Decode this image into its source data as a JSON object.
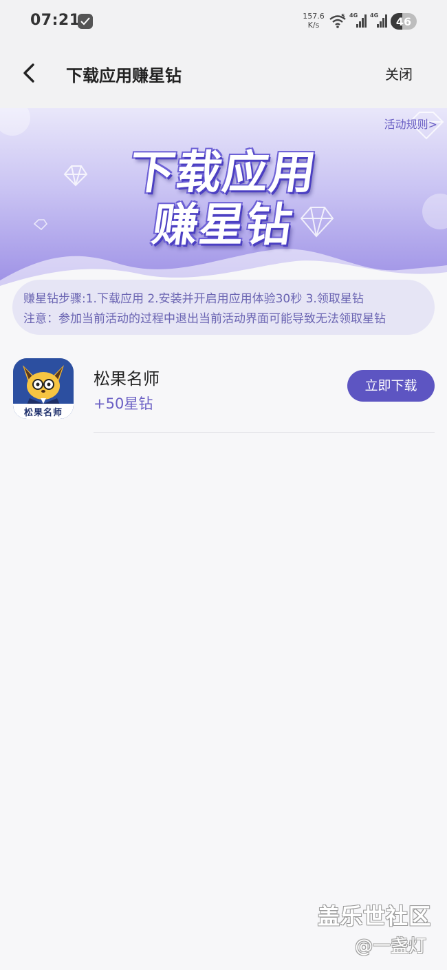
{
  "status_bar": {
    "time": "07:21",
    "net_speed_value": "157.6",
    "net_speed_unit": "K/s",
    "wifi_badge": "5",
    "signal_1_label": "4G",
    "signal_2_label": "4G",
    "battery_level": "46",
    "battery_fraction": 0.46
  },
  "nav": {
    "back_icon": "chevron-left-icon",
    "title": "下载应用赚星钻",
    "close_label": "关闭"
  },
  "banner": {
    "rules_link": "活动规则>",
    "headline_line1": "下载应用",
    "headline_line2": "赚星钻",
    "colors": {
      "top": "#e9e7fa",
      "bottom": "#9b8ee5",
      "text_outline": "#5a4bd0"
    }
  },
  "steps": {
    "line1": "赚星钻步骤:1.下载应用 2.安装并开启用应用体验30秒 3.领取星钻",
    "line2": "注意：参加当前活动的过程中退出当前活动界面可能导致无法领取星钻"
  },
  "app_list": [
    {
      "icon_label": "松果名师",
      "name": "松果名师",
      "reward": "+50星钻",
      "button_label": "立即下载"
    }
  ],
  "watermark": {
    "site": "盖乐世社区",
    "user": "@一盏灯"
  },
  "colors": {
    "accent": "#5d55c2",
    "reward_text": "#6a5fc4",
    "steps_bg": "#e6e5f5",
    "steps_text": "#6a64b2",
    "page_bg": "#f7f7f9"
  }
}
